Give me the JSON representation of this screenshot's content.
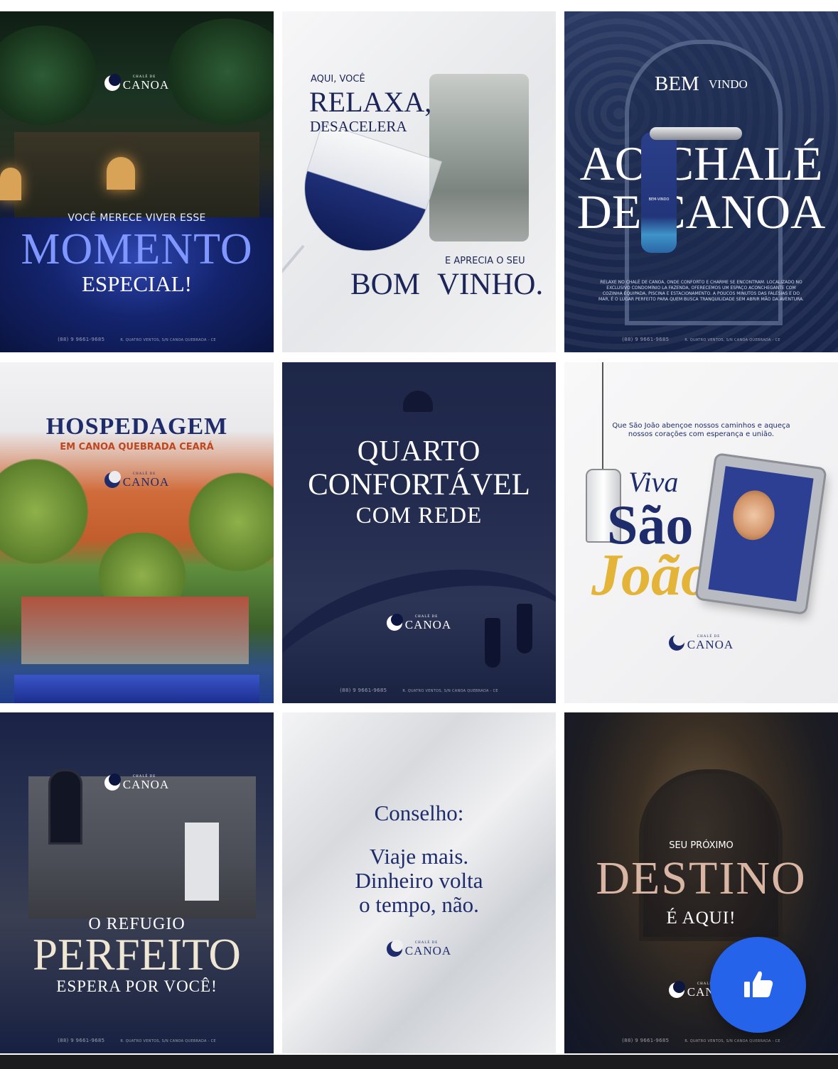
{
  "logo": {
    "small": "CHALÉ DE",
    "large": "CANOA"
  },
  "footer": {
    "phone": "(88) 9 9661-9685",
    "address": "R. QUATRO VENTOS, S/N CANOA QUEBRADA - CE"
  },
  "posts": [
    {
      "line1": "VOCÊ MERECE VIVER ESSE",
      "line2": "MOMENTO",
      "line3": "ESPECIAL!"
    },
    {
      "line1": "AQUI, VOCÊ",
      "line2": "RELAXA,",
      "line3": "DESACELERA",
      "line4": "E APRECIA O SEU",
      "line5": "BOM VINHO."
    },
    {
      "line1": "BEM",
      "line1b": "VINDO",
      "line2": "AO CHALÉ",
      "line3": "DE CANOA",
      "body": "RELAXE NO CHALÉ DE CANOA, ONDE CONFORTO E CHARME SE ENCONTRAM. LOCALIZADO NO EXCLUSIVO CONDOMÍNIO LA FAZENDA, OFERECEMOS UM ESPAÇO ACONCHEGANTE COM COZINHA EQUIPADA, PISCINA E ESTACIONAMENTO. A POUCOS MINUTOS DAS FALÉSIAS E DO MAR, É O LUGAR PERFEITO PARA QUEM BUSCA TRANQUILIDADE SEM ABRIR MÃO DA AVENTURA.",
      "tag": "BEM-VINDO"
    },
    {
      "line1": "HOSPEDAGEM",
      "line2": "EM CANOA QUEBRADA CEARÁ"
    },
    {
      "line1": "QUARTO",
      "line2": "CONFORTÁVEL",
      "line3": "COM REDE"
    },
    {
      "line1": "Que São João abençoe nossos caminhos e aqueça",
      "line2": "nossos corações com esperança e união.",
      "viva": "Viva",
      "sao": "São",
      "joao": "João"
    },
    {
      "line1": "O REFUGIO",
      "line2": "PERFEITO",
      "line3": "ESPERA POR VOCÊ!"
    },
    {
      "line1": "Conselho:",
      "line2": "Viaje mais.",
      "line3": "Dinheiro volta",
      "line4": "o tempo, não."
    },
    {
      "line1": "SEU PRÓXIMO",
      "line2": "DESTINO",
      "line3": "É AQUI!"
    }
  ],
  "like_button": {
    "icon": "thumbs-up-icon"
  }
}
